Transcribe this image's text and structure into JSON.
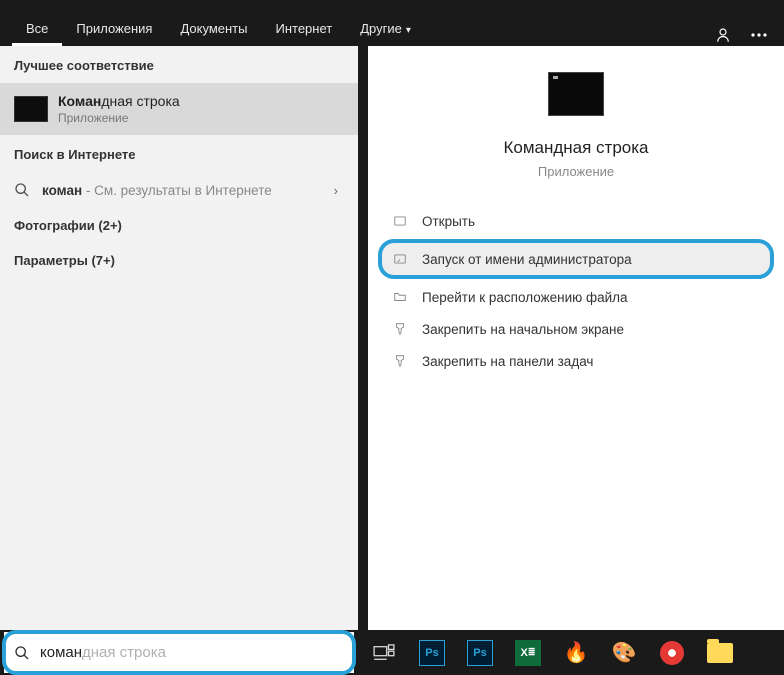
{
  "tabs": {
    "all": "Все",
    "apps": "Приложения",
    "docs": "Документы",
    "internet": "Интернет",
    "other": "Другие"
  },
  "left": {
    "best_match_header": "Лучшее соответствие",
    "result": {
      "title_bold": "Коман",
      "title_rest": "дная строка",
      "subtitle": "Приложение"
    },
    "internet_header": "Поиск в Интернете",
    "internet_item": {
      "query_bold": "коман",
      "suffix": " - См. результаты в Интернете"
    },
    "cat_photos": "Фотографии (2+)",
    "cat_params": "Параметры (7+)"
  },
  "preview": {
    "title": "Командная строка",
    "subtitle": "Приложение",
    "actions": {
      "open": "Открыть",
      "run_admin": "Запуск от имени администратора",
      "open_location": "Перейти к расположению файла",
      "pin_start": "Закрепить на начальном экране",
      "pin_taskbar": "Закрепить на панели задач"
    }
  },
  "search": {
    "typed": "коман",
    "ghost": "дная строка"
  },
  "taskbar_apps": {
    "ps1": "Ps",
    "ps2": "Ps",
    "excel": "X"
  }
}
